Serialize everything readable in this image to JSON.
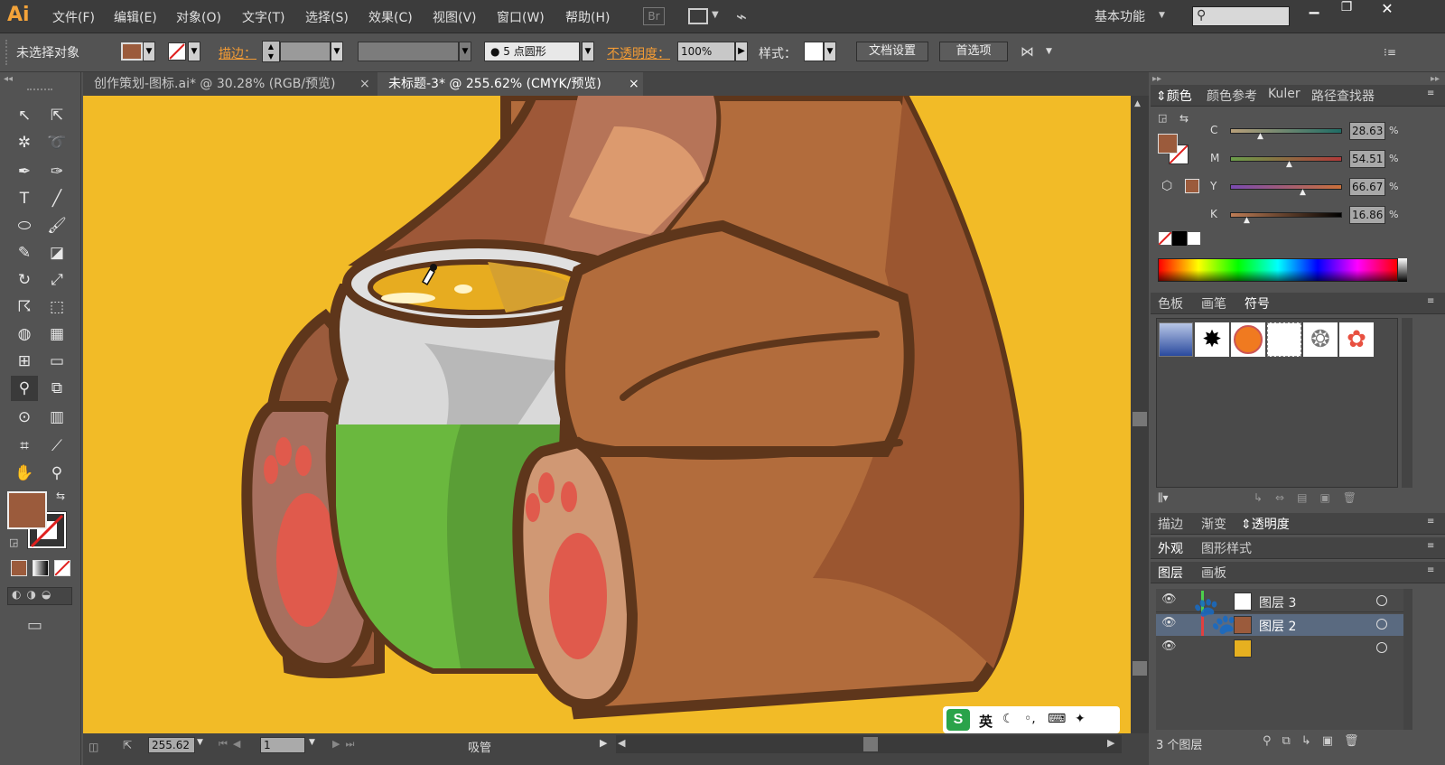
{
  "app": {
    "logo": "Ai"
  },
  "menu": [
    "文件(F)",
    "编辑(E)",
    "对象(O)",
    "文字(T)",
    "选择(S)",
    "效果(C)",
    "视图(V)",
    "窗口(W)",
    "帮助(H)"
  ],
  "menu_right": {
    "bridge": "Br",
    "workspace": "基本功能",
    "search_placeholder": ""
  },
  "control": {
    "selection": "未选择对象",
    "stroke_label": "描边：",
    "brush": "5 点圆形",
    "opacity_label": "不透明度：",
    "opacity_value": "100%",
    "style_label": "样式：",
    "doc_setup": "文档设置",
    "prefs": "首选项"
  },
  "tabs": [
    {
      "label": "创作策划-图标.ai* @ 30.28% (RGB/预览)",
      "active": false
    },
    {
      "label": "未标题-3* @ 255.62% (CMYK/预览)",
      "active": true
    }
  ],
  "status": {
    "zoom": "255.62",
    "page": "1",
    "tool": "吸管"
  },
  "ime": {
    "label": "英"
  },
  "color_panel": {
    "tabs": [
      "颜色",
      "颜色参考",
      "Kuler",
      "路径查找器"
    ],
    "channels": [
      {
        "name": "C",
        "value": "28.63",
        "percent": 0.2863
      },
      {
        "name": "M",
        "value": "54.51",
        "percent": 0.5451
      },
      {
        "name": "Y",
        "value": "66.67",
        "percent": 0.6667
      },
      {
        "name": "K",
        "value": "16.86",
        "percent": 0.1686
      }
    ],
    "unit": "%",
    "fill_color": "#9b5b3c"
  },
  "swatch_panel": {
    "tabs": [
      "色板",
      "画笔",
      "符号"
    ]
  },
  "lower_tabs1": [
    "描边",
    "渐变",
    "透明度"
  ],
  "lower_tabs2": [
    "外观",
    "图形样式"
  ],
  "layers_panel": {
    "tabs": [
      "图层",
      "画板"
    ],
    "layers": [
      {
        "name": "图层 3"
      },
      {
        "name": "图层 2"
      }
    ],
    "footer": "3 个图层"
  }
}
